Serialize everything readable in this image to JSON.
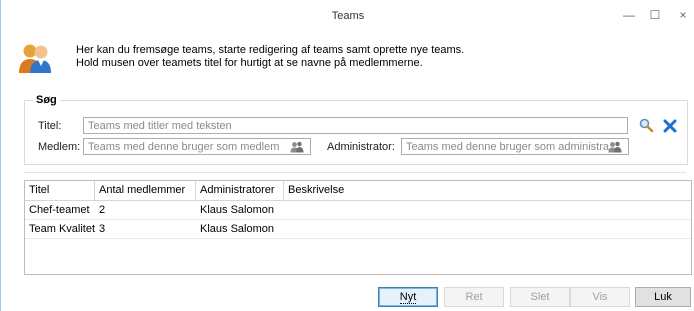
{
  "window": {
    "title": "Teams",
    "minimize_symbol": "—",
    "maximize_symbol": "☐",
    "close_symbol": "×"
  },
  "intro": {
    "icon": "team-users-icon",
    "line1": "Her kan du fremsøge teams, starte redigering af teams samt oprette nye teams.",
    "line2": "Hold musen over teamets titel for hurtigt at se navne på medlemmerne."
  },
  "search": {
    "group_title": "Søg",
    "title_label": "Titel:",
    "title_placeholder": "Teams med titler med teksten",
    "member_label": "Medlem:",
    "member_placeholder": "Teams med denne bruger som medlem",
    "admin_label": "Administrator:",
    "admin_placeholder": "Teams med denne bruger som administra...",
    "search_icon": "magnifier-icon",
    "clear_icon": "blue-x-icon",
    "pick_user_icon": "users-picker-icon"
  },
  "grid": {
    "columns": [
      "Titel",
      "Antal medlemmer",
      "Administratorer",
      "Beskrivelse"
    ],
    "rows": [
      [
        "Chef-teamet",
        "2",
        "Klaus Salomon",
        ""
      ],
      [
        "Team Kvalitet",
        "3",
        "Klaus Salomon",
        ""
      ]
    ]
  },
  "buttons": {
    "new": "Nyt",
    "edit": "Ret",
    "delete": "Slet",
    "view": "Vis",
    "close": "Luk"
  },
  "colors": {
    "clear_icon": "#1e6fd1",
    "default_button_border": "#3c7fb1"
  }
}
